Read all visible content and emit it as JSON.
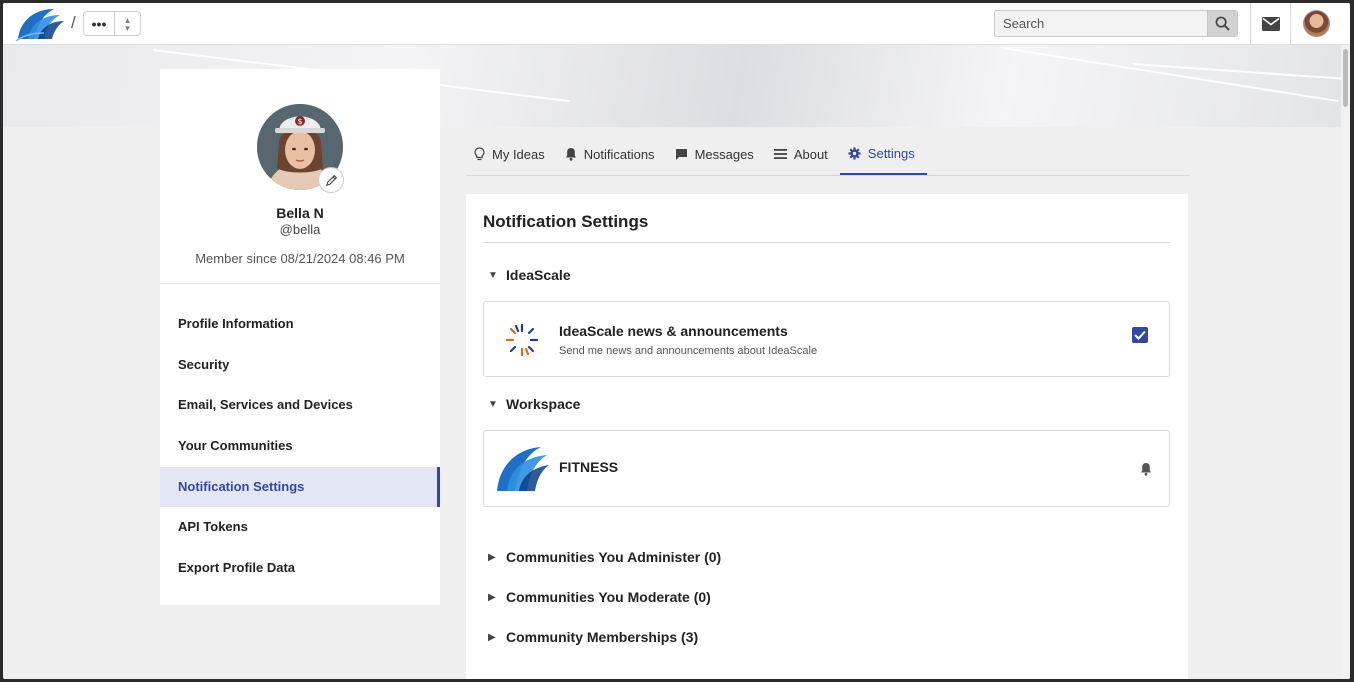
{
  "topbar": {
    "crumb_dots": "•••",
    "search_placeholder": "Search",
    "slash": "/"
  },
  "profile": {
    "name": "Bella N",
    "handle": "@bella",
    "member_since": "Member since 08/21/2024 08:46 PM"
  },
  "sidebar": {
    "items": [
      {
        "label": "Profile Information"
      },
      {
        "label": "Security"
      },
      {
        "label": "Email, Services and Devices"
      },
      {
        "label": "Your Communities"
      },
      {
        "label": "Notification Settings",
        "active": true
      },
      {
        "label": "API Tokens"
      },
      {
        "label": "Export Profile Data"
      }
    ]
  },
  "tabs": [
    {
      "label": "My Ideas",
      "icon": "lightbulb-icon"
    },
    {
      "label": "Notifications",
      "icon": "bell-icon"
    },
    {
      "label": "Messages",
      "icon": "chat-icon"
    },
    {
      "label": "About",
      "icon": "menu-icon"
    },
    {
      "label": "Settings",
      "icon": "gear-icon",
      "active": true
    }
  ],
  "panel": {
    "title": "Notification Settings",
    "ideascale_section": "IdeaScale",
    "ideascale_row": {
      "title": "IdeaScale news & announcements",
      "subtitle": "Send me news and announcements about IdeaScale",
      "checked": true
    },
    "workspace_section": "Workspace",
    "workspace_row": {
      "title": "FITNESS"
    },
    "collapsed_sections": [
      "Communities You Administer (0)",
      "Communities You Moderate (0)",
      "Community Memberships (3)"
    ]
  },
  "colors": {
    "accent": "#3348a4",
    "active_bg": "#e3e7f5"
  }
}
